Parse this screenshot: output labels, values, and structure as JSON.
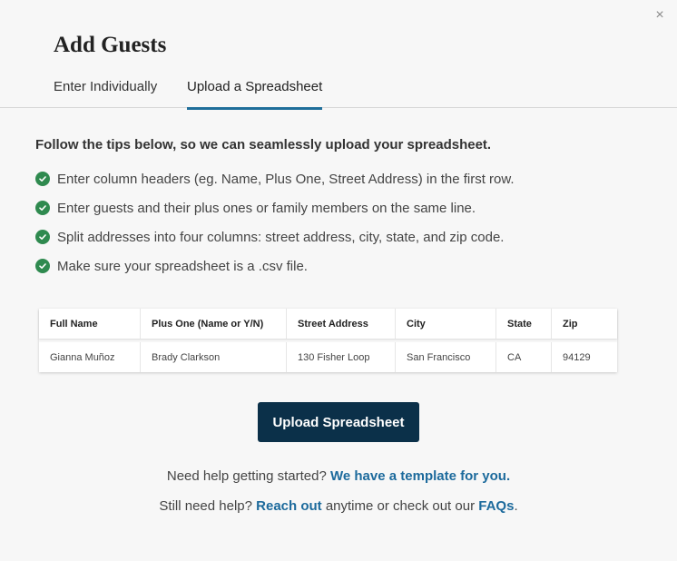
{
  "modal": {
    "title": "Add Guests",
    "close_symbol": "×"
  },
  "tabs": [
    {
      "label": "Enter Individually",
      "active": false
    },
    {
      "label": "Upload a Spreadsheet",
      "active": true
    }
  ],
  "intro": "Follow the tips below, so we can seamlessly upload your spreadsheet.",
  "tips": [
    "Enter column headers (eg. Name, Plus One, Street Address) in the first row.",
    "Enter guests and their plus ones or family members on the same line.",
    "Split addresses into four columns: street address, city, state, and zip code.",
    "Make sure your spreadsheet is a .csv file."
  ],
  "sample_table": {
    "headers": [
      "Full Name",
      "Plus One (Name or Y/N)",
      "Street Address",
      "City",
      "State",
      "Zip"
    ],
    "row": [
      "Gianna Muñoz",
      "Brady Clarkson",
      "130 Fisher Loop",
      "San Francisco",
      "CA",
      "94129"
    ]
  },
  "upload_button_label": "Upload Spreadsheet",
  "help": {
    "line1_prefix": "Need help getting started? ",
    "line1_link": "We have a template for you.",
    "line2_prefix": "Still need help? ",
    "line2_link1": "Reach out",
    "line2_middle": " anytime or check out our ",
    "line2_link2": "FAQs",
    "line2_suffix": "."
  },
  "colors": {
    "accent": "#1f6e9a",
    "check_green": "#2f8a4f",
    "button_bg": "#0b3049",
    "link": "#1c6a9c"
  },
  "icons": {
    "close": "close-icon",
    "check": "check-circle-icon"
  }
}
